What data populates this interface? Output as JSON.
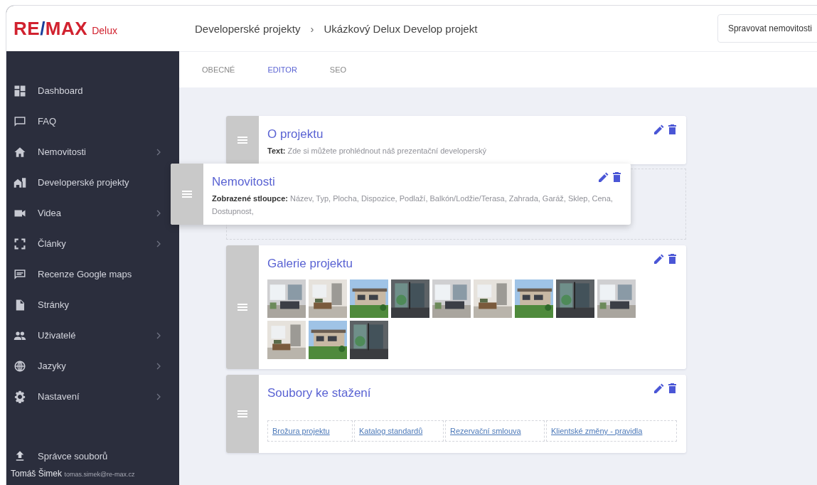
{
  "logo": {
    "left": "RE",
    "slash": "/",
    "right": "MAX",
    "tag": "Delux"
  },
  "sidebar": {
    "items": [
      {
        "label": "Dashboard",
        "has_submenu": false
      },
      {
        "label": "FAQ",
        "has_submenu": false
      },
      {
        "label": "Nemovitosti",
        "has_submenu": true
      },
      {
        "label": "Developerské projekty",
        "has_submenu": false
      },
      {
        "label": "Videa",
        "has_submenu": true
      },
      {
        "label": "Články",
        "has_submenu": true
      },
      {
        "label": "Recenze Google maps",
        "has_submenu": false
      },
      {
        "label": "Stránky",
        "has_submenu": false
      },
      {
        "label": "Uživatelé",
        "has_submenu": true
      },
      {
        "label": "Jazyky",
        "has_submenu": true
      },
      {
        "label": "Nastavení",
        "has_submenu": true
      }
    ],
    "file_manager": "Správce souborů",
    "user": {
      "name": "Tomáš Šimek",
      "email": "tomas.simek@re-max.cz"
    }
  },
  "breadcrumb": [
    "Developerské projekty",
    "Ukázkový Delux Develop projekt"
  ],
  "breadcrumb_separator": "›",
  "header_button": "Spravovat nemovitosti",
  "tabs": [
    {
      "label": "OBECNÉ",
      "selected": false
    },
    {
      "label": "EDITOR",
      "selected": true
    },
    {
      "label": "SEO",
      "selected": false
    }
  ],
  "blocks": [
    {
      "kind": "text",
      "title": "O projektu",
      "dragging": false,
      "field_label": "Text:",
      "field_value": "Zde si můžete prohlédnout náš prezentační developerský"
    },
    {
      "kind": "text",
      "title": "Nemovitosti",
      "dragging": true,
      "field_label": "Zobrazené stloupce:",
      "field_value": "Název, Typ, Plocha, Dispozice, Podlaží, Balkón/Lodžie/Terasa, Zahrada, Garáž, Sklep, Cena, Dostupnost,"
    },
    {
      "kind": "gallery",
      "title": "Galerie projektu",
      "dragging": false
    },
    {
      "kind": "files",
      "title": "Soubory ke stažení",
      "dragging": false,
      "files": [
        "Brožura projektu",
        "Katalog standardů",
        "Rezervační smlouva",
        "Klientské změny - pravidla"
      ]
    }
  ]
}
